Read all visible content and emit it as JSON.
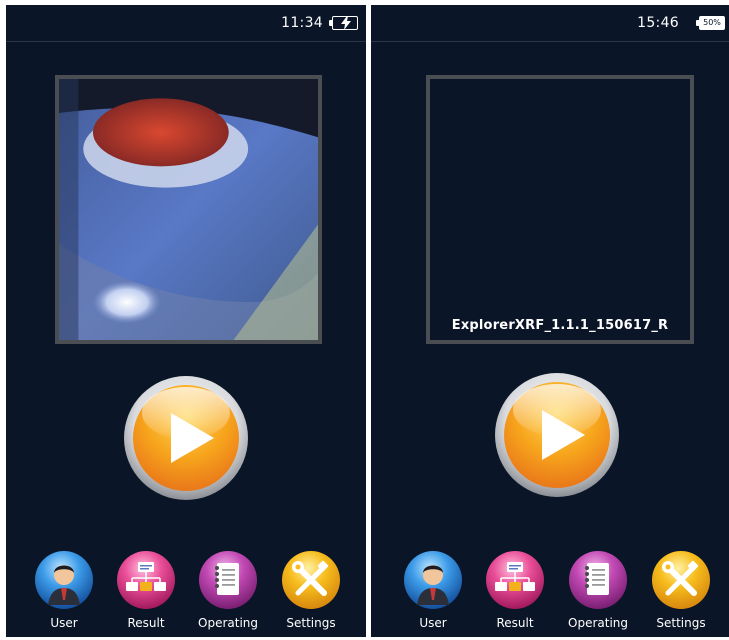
{
  "screens": [
    {
      "time": "11:34",
      "battery": {
        "state": "charging",
        "label": ""
      },
      "viewport": {
        "type": "camera-image",
        "caption": ""
      },
      "play_button": {
        "icon": "play-icon"
      },
      "nav": [
        {
          "label": "User",
          "icon": "user-icon",
          "color": "#2a7fd4"
        },
        {
          "label": "Result",
          "icon": "result-icon",
          "color": "#e0408e"
        },
        {
          "label": "Operating",
          "icon": "operating-icon",
          "color": "#b43ba6"
        },
        {
          "label": "Settings",
          "icon": "settings-icon",
          "color": "#f3b21b"
        }
      ]
    },
    {
      "time": "15:46",
      "battery": {
        "state": "level",
        "label": "50%"
      },
      "viewport": {
        "type": "empty",
        "caption": "ExplorerXRF_1.1.1_150617_R"
      },
      "play_button": {
        "icon": "play-icon"
      },
      "nav": [
        {
          "label": "User",
          "icon": "user-icon",
          "color": "#2a7fd4"
        },
        {
          "label": "Result",
          "icon": "result-icon",
          "color": "#e0408e"
        },
        {
          "label": "Operating",
          "icon": "operating-icon",
          "color": "#b43ba6"
        },
        {
          "label": "Settings",
          "icon": "settings-icon",
          "color": "#f3b21b"
        }
      ]
    }
  ],
  "colors": {
    "background": "#0a1527",
    "accent_play": "#f5a81f",
    "frame": "#4a4d52"
  }
}
